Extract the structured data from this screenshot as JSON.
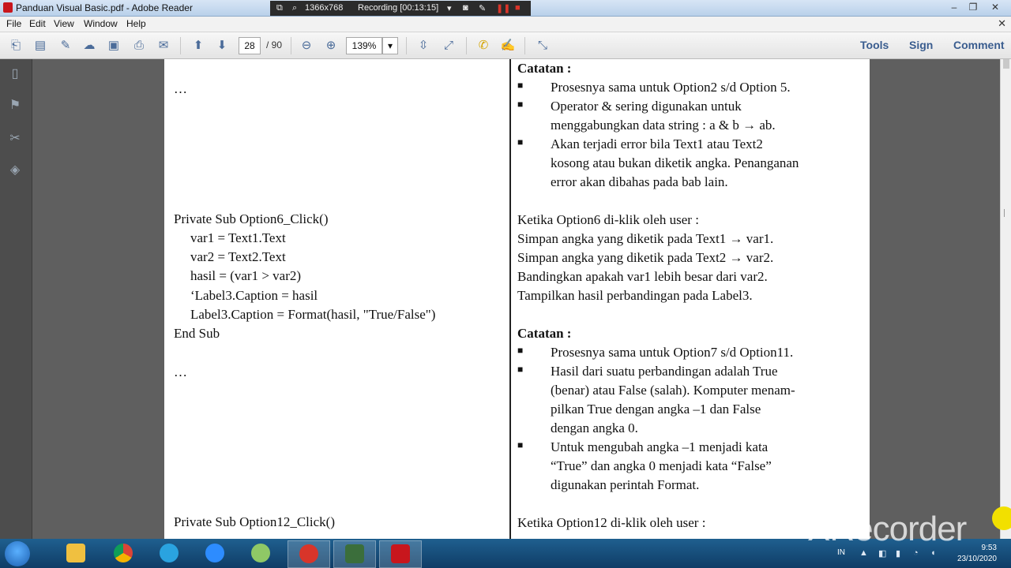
{
  "window": {
    "title": "Panduan Visual Basic.pdf - Adobe Reader",
    "recorder": {
      "resolution": "1366x768",
      "status": "Recording [00:13:15]"
    }
  },
  "menu": [
    "File",
    "Edit",
    "View",
    "Window",
    "Help"
  ],
  "toolbar": {
    "page_current": "28",
    "page_total": "/ 90",
    "zoom": "139%",
    "tools": "Tools",
    "sign": "Sign",
    "comment": "Comment"
  },
  "document": {
    "left": [
      "…",
      "Private Sub Option6_Click()",
      "var1 = Text1.Text",
      "var2 = Text2.Text",
      "hasil = (var1 > var2)",
      "‘Label3.Caption = hasil",
      "Label3.Caption = Format(hasil, \"True/False\")",
      "End Sub",
      "…",
      "Private Sub Option12_Click()"
    ],
    "right": {
      "catatan1_title": "Catatan :",
      "catatan1": [
        "Prosesnya sama untuk Option2 s/d Option 5.",
        "Operator & sering digunakan untuk",
        "menggabungkan data string : a & b → ab.",
        "Akan terjadi error bila Text1 atau Text2",
        "kosong atau bukan diketik angka. Penanganan",
        "error akan dibahas pada bab lain."
      ],
      "option6": [
        "Ketika Option6 di-klik oleh user :",
        "Simpan angka yang diketik pada Text1 → var1.",
        "Simpan angka yang diketik pada Text2 → var2.",
        "Bandingkan apakah var1 lebih besar dari var2.",
        "Tampilkan hasil perbandingan pada Label3."
      ],
      "catatan2_title": "Catatan :",
      "catatan2": [
        "Prosesnya sama untuk Option7 s/d Option11.",
        "Hasil dari suatu perbandingan adalah True",
        "(benar) atau False (salah). Komputer menam-",
        "pilkan True dengan angka –1 dan False",
        "dengan angka 0.",
        "Untuk mengubah angka –1 menjadi kata",
        "“True” dan angka 0 menjadi kata “False”",
        "digunakan perintah Format."
      ],
      "option12": "Ketika Option12 di-klik oleh user :"
    }
  },
  "taskbar": {
    "lang": "IN",
    "time": "9:53",
    "date": "23/10/2020",
    "watermark": "XRecorder"
  }
}
